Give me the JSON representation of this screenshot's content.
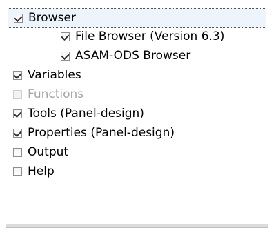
{
  "items": [
    {
      "label": "Browser",
      "checked": true,
      "enabled": true,
      "selected": true,
      "indent": 0
    },
    {
      "label": "File Browser (Version 6.3)",
      "checked": true,
      "enabled": true,
      "selected": false,
      "indent": 1
    },
    {
      "label": "ASAM-ODS Browser",
      "checked": true,
      "enabled": true,
      "selected": false,
      "indent": 1
    },
    {
      "label": "Variables",
      "checked": true,
      "enabled": true,
      "selected": false,
      "indent": 0
    },
    {
      "label": "Functions",
      "checked": false,
      "enabled": false,
      "selected": false,
      "indent": 0
    },
    {
      "label": "Tools (Panel-design)",
      "checked": true,
      "enabled": true,
      "selected": false,
      "indent": 0
    },
    {
      "label": "Properties (Panel-design)",
      "checked": true,
      "enabled": true,
      "selected": false,
      "indent": 0
    },
    {
      "label": "Output",
      "checked": false,
      "enabled": true,
      "selected": false,
      "indent": 0
    },
    {
      "label": "Help",
      "checked": false,
      "enabled": true,
      "selected": false,
      "indent": 0
    }
  ]
}
